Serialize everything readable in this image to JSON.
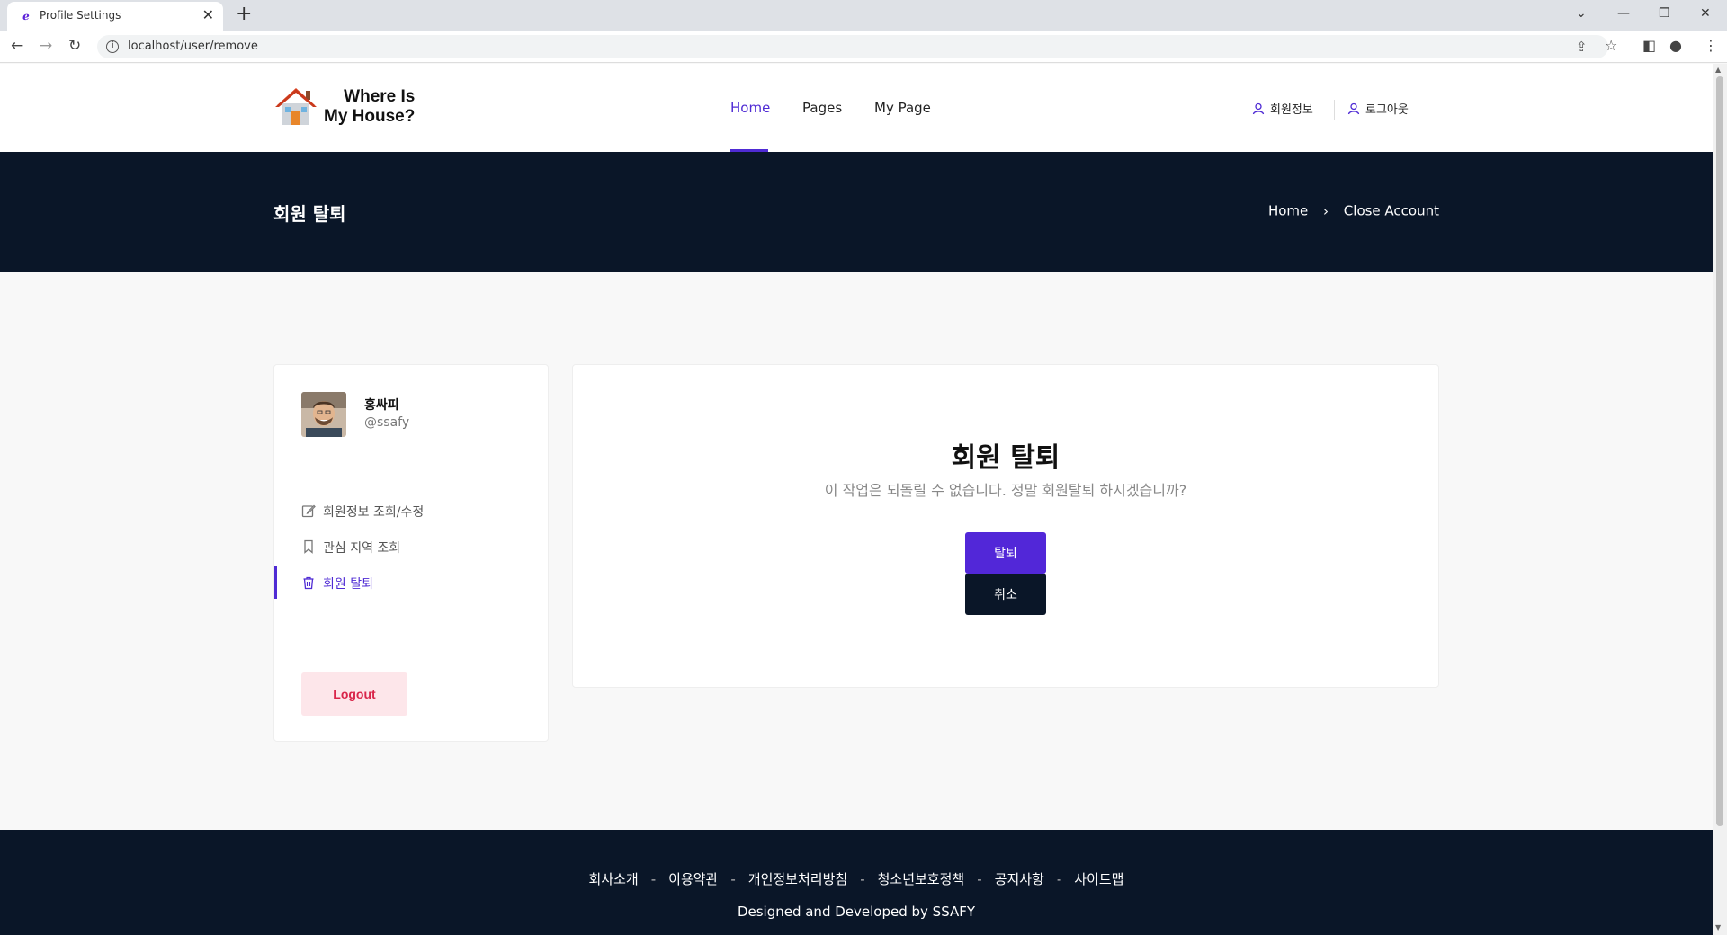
{
  "browser": {
    "tab_title": "Profile Settings",
    "url": "localhost/user/remove"
  },
  "header": {
    "logo_line1": "Where Is",
    "logo_line2": "My House?",
    "nav": [
      {
        "label": "Home",
        "active": true
      },
      {
        "label": "Pages",
        "active": false
      },
      {
        "label": "My Page",
        "active": false
      }
    ],
    "user_links": [
      {
        "label": "회원정보",
        "icon": "user-icon"
      },
      {
        "label": "로그아웃",
        "icon": "user-icon"
      }
    ]
  },
  "banner": {
    "title": "회원 탈퇴",
    "breadcrumb": [
      "Home",
      "Close Account"
    ]
  },
  "sidebar": {
    "name": "홍싸피",
    "handle": "@ssafy",
    "items": [
      {
        "label": "회원정보 조회/수정",
        "icon": "edit-icon",
        "active": false
      },
      {
        "label": "관심 지역 조회",
        "icon": "bookmark-icon",
        "active": false
      },
      {
        "label": "회원 탈퇴",
        "icon": "trash-icon",
        "active": true
      }
    ],
    "logout_label": "Logout"
  },
  "main": {
    "title": "회원 탈퇴",
    "description": "이 작업은 되돌릴 수 없습니다. 정말 회원탈퇴 하시겠습니까?",
    "confirm_label": "탈퇴",
    "cancel_label": "취소"
  },
  "footer": {
    "links": [
      "회사소개",
      "이용약관",
      "개인정보처리방침",
      "청소년보호정책",
      "공지사항",
      "사이트맵"
    ],
    "copyright": "Designed and Developed by SSAFY"
  },
  "colors": {
    "accent": "#4f2bd4",
    "dark": "#0a1628",
    "danger": "#d9254a",
    "danger_bg": "#fde6ea"
  }
}
